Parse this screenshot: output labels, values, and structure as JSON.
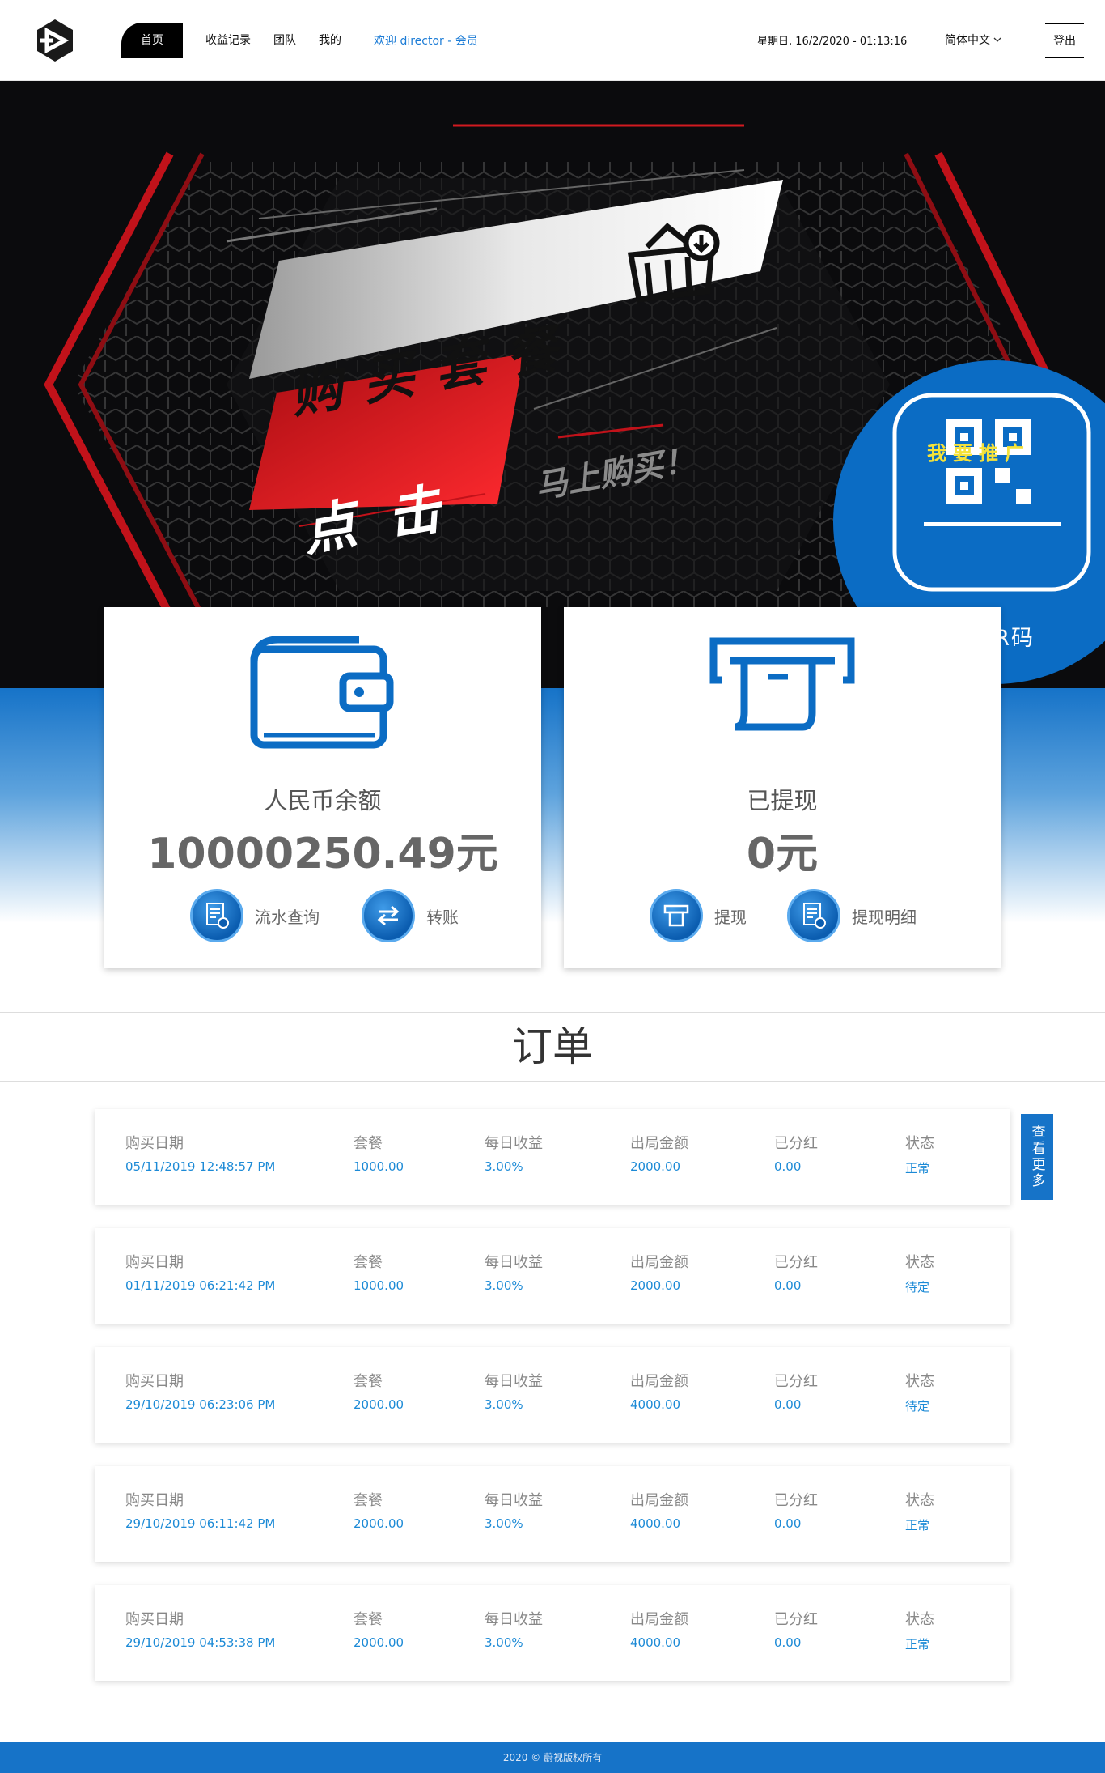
{
  "header": {
    "nav": [
      "首页",
      "收益记录",
      "团队",
      "我的"
    ],
    "welcome": "欢迎 director - 会员",
    "datetime": "星期日, 16/2/2020 - 01:13:16",
    "language": "简体中文",
    "logout": "登出"
  },
  "banner": {
    "headline": "购买套餐",
    "click": "点击",
    "buy_now": "马上购买！",
    "promo_title": "我要推广",
    "scan_text": "扫描QR码"
  },
  "balance_card": {
    "label": "人民币余额",
    "value": "10000250.49元",
    "actions": [
      "流水查询",
      "转账"
    ]
  },
  "withdraw_card": {
    "label": "已提现",
    "value": "0元",
    "actions": [
      "提现",
      "提现明细"
    ]
  },
  "orders": {
    "title": "订单",
    "columns": [
      "购买日期",
      "套餐",
      "每日收益",
      "出局金额",
      "已分红",
      "状态"
    ],
    "rows": [
      [
        "05/11/2019 12:48:57 PM",
        "1000.00",
        "3.00%",
        "2000.00",
        "0.00",
        "正常"
      ],
      [
        "01/11/2019 06:21:42 PM",
        "1000.00",
        "3.00%",
        "2000.00",
        "0.00",
        "待定"
      ],
      [
        "29/10/2019 06:23:06 PM",
        "2000.00",
        "3.00%",
        "4000.00",
        "0.00",
        "待定"
      ],
      [
        "29/10/2019 06:11:42 PM",
        "2000.00",
        "3.00%",
        "4000.00",
        "0.00",
        "正常"
      ],
      [
        "29/10/2019 04:53:38 PM",
        "2000.00",
        "3.00%",
        "4000.00",
        "0.00",
        "正常"
      ]
    ],
    "more_label": "查看更多"
  },
  "footer": {
    "text": "2020 © 蔚视版权所有"
  },
  "colors": {
    "accent": "#1673c8",
    "link": "#1c8ad6",
    "banner_red": "#e3191f"
  }
}
